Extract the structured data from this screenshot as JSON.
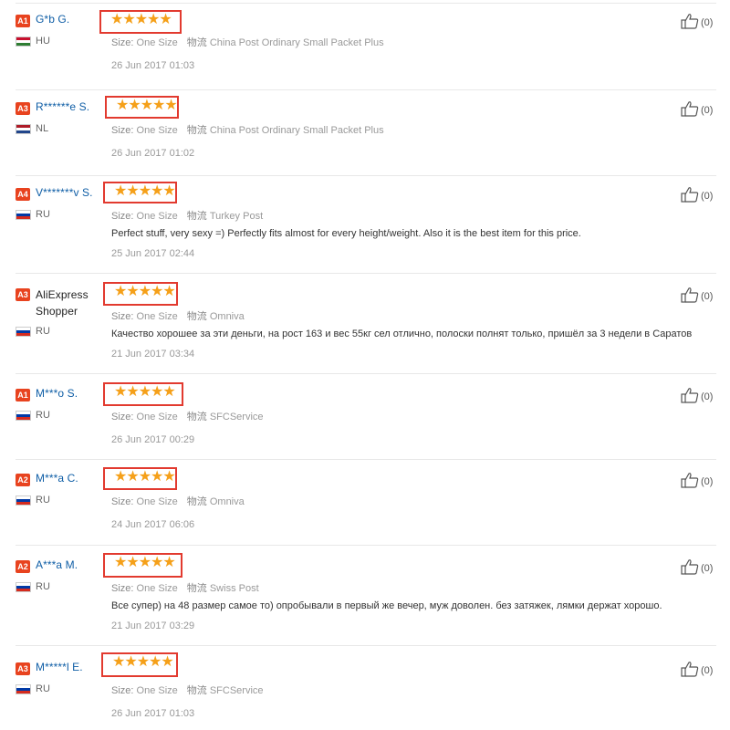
{
  "colors": {
    "star": "#f5a019",
    "highlight_box": "#e23a2f",
    "badge": "#e8431f",
    "name_link": "#0f5ea6"
  },
  "icons": {
    "rating": "star-icon",
    "like": "thumbs-up-icon",
    "flag": "flag-icon"
  },
  "size_label": "Size:",
  "shipping_label": "物流",
  "reviews": [
    {
      "badge": "A1",
      "name": "G*b G.",
      "country": "HU",
      "flag": [
        "#c8102e",
        "#ffffff",
        "#2e7d32"
      ],
      "rating": 5,
      "stars": "★★★★★",
      "size": "One Size",
      "shipping": "China Post Ordinary Small Packet Plus",
      "comment": "",
      "date": "26 Jun 2017 01:03",
      "likes": "(0)"
    },
    {
      "badge": "A3",
      "name": "R******e S.",
      "country": "NL",
      "flag": [
        "#ae1c28",
        "#ffffff",
        "#21468b"
      ],
      "rating": 5,
      "stars": "★★★★★",
      "size": "One Size",
      "shipping": "China Post Ordinary Small Packet Plus",
      "comment": "",
      "date": "26 Jun 2017 01:02",
      "likes": "(0)"
    },
    {
      "badge": "A4",
      "name": "V*******v S.",
      "country": "RU",
      "flag": [
        "#ffffff",
        "#0039a6",
        "#d52b1e"
      ],
      "rating": 5,
      "stars": "★★★★★",
      "size": "One Size",
      "shipping": "Turkey Post",
      "comment": "Perfect stuff, very sexy =) Perfectly fits almost for every height/weight. Also it is the best item for this price.",
      "date": "25 Jun 2017 02:44",
      "likes": "(0)"
    },
    {
      "badge": "A3",
      "name": "AliExpress Shopper",
      "country": "RU",
      "flag": [
        "#ffffff",
        "#0039a6",
        "#d52b1e"
      ],
      "rating": 5,
      "stars": "★★★★★",
      "size": "One Size",
      "shipping": "Omniva",
      "comment": "Качество хорошее за эти деньги, на рост 163 и вес 55кг сел отлично, полоски полнят только, пришёл за 3 недели в Саратов",
      "date": "21 Jun 2017 03:34",
      "likes": "(0)"
    },
    {
      "badge": "A1",
      "name": "M***o S.",
      "country": "RU",
      "flag": [
        "#ffffff",
        "#0039a6",
        "#d52b1e"
      ],
      "rating": 5,
      "stars": "★★★★★",
      "size": "One Size",
      "shipping": "SFCService",
      "comment": "",
      "date": "26 Jun 2017 00:29",
      "likes": "(0)"
    },
    {
      "badge": "A2",
      "name": "M***a C.",
      "country": "RU",
      "flag": [
        "#ffffff",
        "#0039a6",
        "#d52b1e"
      ],
      "rating": 5,
      "stars": "★★★★★",
      "size": "One Size",
      "shipping": "Omniva",
      "comment": "",
      "date": "24 Jun 2017 06:06",
      "likes": "(0)"
    },
    {
      "badge": "A2",
      "name": "A***a M.",
      "country": "RU",
      "flag": [
        "#ffffff",
        "#0039a6",
        "#d52b1e"
      ],
      "rating": 5,
      "stars": "★★★★★",
      "size": "One Size",
      "shipping": "Swiss Post",
      "comment": "Все супер) на 48 размер самое то) опробывали в первый же вечер, муж доволен. без затяжек, лямки держат хорошо.",
      "date": "21 Jun 2017 03:29",
      "likes": "(0)"
    },
    {
      "badge": "A3",
      "name": "M*****l E.",
      "country": "RU",
      "flag": [
        "#ffffff",
        "#0039a6",
        "#d52b1e"
      ],
      "rating": 5,
      "stars": "★★★★★",
      "size": "One Size",
      "shipping": "SFCService",
      "comment": "",
      "date": "26 Jun 2017 01:03",
      "likes": "(0)"
    }
  ]
}
